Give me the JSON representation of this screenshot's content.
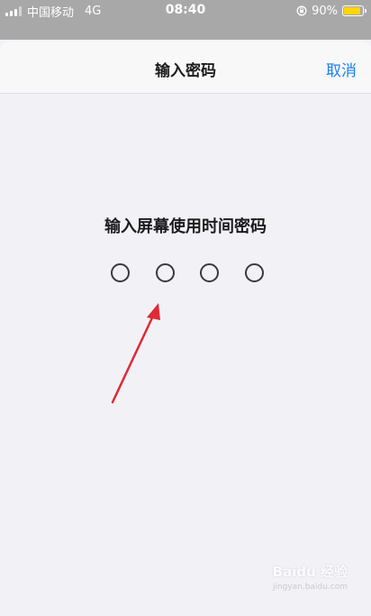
{
  "status_bar": {
    "carrier": "中国移动",
    "network": "4G",
    "time": "08:40",
    "battery_percent": "90%",
    "battery_level": 0.9,
    "battery_color": "#ffd60a"
  },
  "nav": {
    "title": "输入密码",
    "cancel_label": "取消",
    "accent_color": "#1a7ff2"
  },
  "passcode": {
    "prompt": "输入屏幕使用时间密码",
    "digits_total": 4,
    "digits_entered": 0
  },
  "annotation": {
    "arrow_color": "#e02a35"
  },
  "watermark": {
    "brand": "Baidu 经验",
    "url": "jingyan.baidu.com"
  }
}
